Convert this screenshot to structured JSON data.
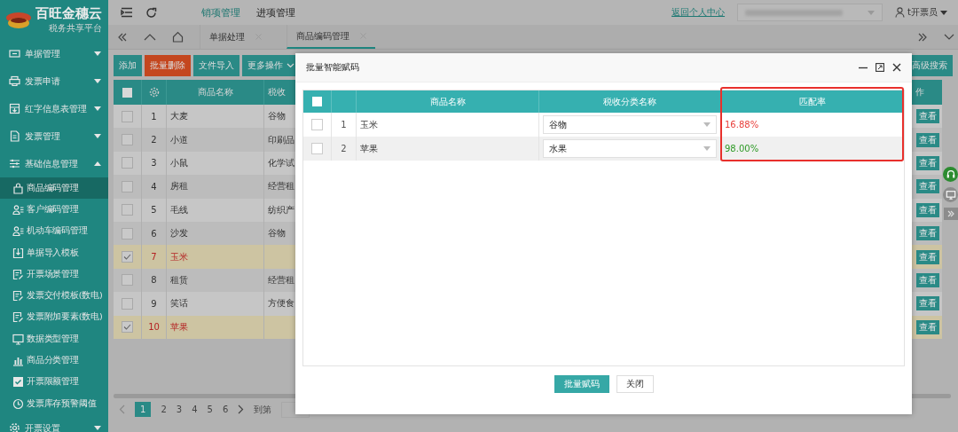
{
  "sidebar": {
    "brand": "百旺金穗云",
    "subtitle": "税务共享平台",
    "items": [
      {
        "label": "单据管理",
        "expanded": false
      },
      {
        "label": "发票申请",
        "expanded": false
      },
      {
        "label": "红字信息表管理",
        "expanded": false
      },
      {
        "label": "发票管理",
        "expanded": false
      },
      {
        "label": "基础信息管理",
        "expanded": true,
        "children": [
          {
            "label": "商品编码管理",
            "selected": true
          },
          {
            "label": "客户编码管理",
            "selected": false
          },
          {
            "label": "机动车编码管理",
            "selected": false
          },
          {
            "label": "单据导入模板",
            "selected": false
          },
          {
            "label": "开票场景管理",
            "selected": false
          },
          {
            "label": "发票交付模板(数电)",
            "selected": false
          },
          {
            "label": "发票附加要素(数电)",
            "selected": false
          },
          {
            "label": "数据类型管理",
            "selected": false
          },
          {
            "label": "商品分类管理",
            "selected": false
          },
          {
            "label": "开票限额管理",
            "selected": false
          },
          {
            "label": "发票库存预警阈值",
            "selected": false
          }
        ]
      },
      {
        "label": "开票设置",
        "expanded": false
      }
    ]
  },
  "top_nav": {
    "items": [
      {
        "label": "销项管理",
        "selected": true
      },
      {
        "label": "进项管理",
        "selected": false
      }
    ],
    "link": "返回个人中心",
    "user": "t开票员"
  },
  "tabs": [
    {
      "label": "单据处理",
      "selected": false
    },
    {
      "label": "商品编码管理",
      "selected": true
    }
  ],
  "toolbar": {
    "buttons": [
      {
        "label": "添加",
        "kind": "normal"
      },
      {
        "label": "批量删除",
        "kind": "danger"
      },
      {
        "label": "文件导入",
        "kind": "normal"
      },
      {
        "label": "更多操作",
        "kind": "dropdown"
      }
    ],
    "search_button": "高级搜索"
  },
  "table": {
    "select_all": {
      "checked": false
    },
    "columns": [
      "商品名称",
      "税收",
      "作"
    ],
    "rows": [
      {
        "number": "1",
        "name": "大麦",
        "category": "谷物",
        "action": "查看",
        "selected": false
      },
      {
        "number": "2",
        "name": "小道",
        "category": "印刷品",
        "action": "查看",
        "selected": false
      },
      {
        "number": "3",
        "name": "小鼠",
        "category": "化学试",
        "action": "查看",
        "selected": false
      },
      {
        "number": "4",
        "name": "房租",
        "category": "经营租",
        "action": "查看",
        "selected": false
      },
      {
        "number": "5",
        "name": "毛线",
        "category": "纺织产",
        "action": "查看",
        "selected": false
      },
      {
        "number": "6",
        "name": "沙发",
        "category": "谷物",
        "action": "查看",
        "selected": false
      },
      {
        "number": "7",
        "name": "玉米",
        "action": "查看",
        "selected": true
      },
      {
        "number": "8",
        "name": "租赁",
        "category": "经营租",
        "action": "查看",
        "selected": false
      },
      {
        "number": "9",
        "name": "笑话",
        "category": "方便食",
        "action": "查看",
        "selected": false
      },
      {
        "number": "10",
        "name": "苹果",
        "action": "查看",
        "selected": true
      }
    ]
  },
  "pagination": {
    "pages": [
      {
        "label": "1",
        "selected": true
      },
      {
        "label": "2",
        "selected": false
      },
      {
        "label": "3",
        "selected": false
      },
      {
        "label": "4",
        "selected": false
      },
      {
        "label": "5",
        "selected": false
      },
      {
        "label": "6",
        "selected": false
      }
    ],
    "goto_label": "到第"
  },
  "dialog": {
    "title": "批量智能赋码",
    "select_all": {
      "checked": false
    },
    "columns": [
      "商品名称",
      "税收分类名称",
      "匹配率"
    ],
    "rows": [
      {
        "number": "1",
        "name": "玉米",
        "category": "谷物",
        "rate": "16.88%",
        "color": "#e8403c",
        "checked": false
      },
      {
        "number": "2",
        "name": "苹果",
        "category": "水果",
        "rate": "98.00%",
        "color": "#2e9a26",
        "checked": false
      }
    ],
    "buttons": [
      {
        "label": "批量赋码",
        "kind": "primary"
      },
      {
        "label": "关闭",
        "kind": "default"
      }
    ]
  }
}
